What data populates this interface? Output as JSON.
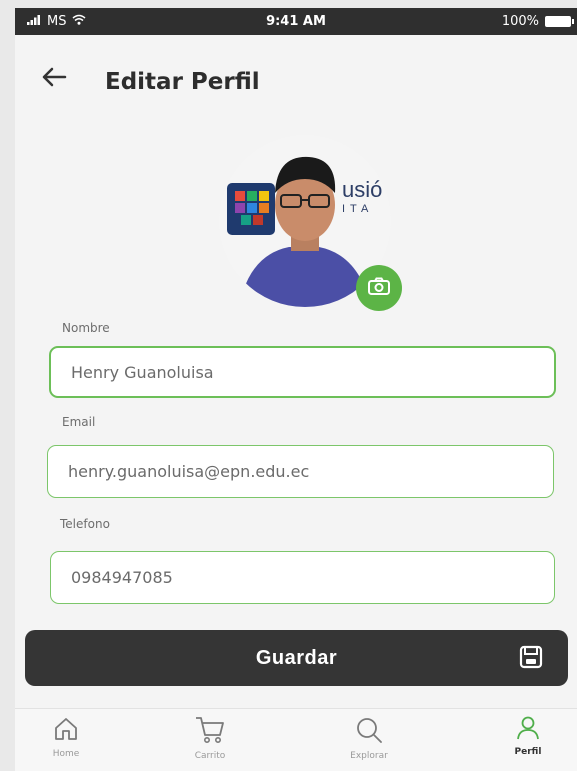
{
  "status_bar": {
    "carrier": "MS",
    "time": "9:41 AM",
    "battery": "100%"
  },
  "header": {
    "title": "Editar Perfil"
  },
  "form": {
    "name_label": "Nombre",
    "name_value": "Henry Guanoluisa",
    "email_label": "Email",
    "email_value": "henry.guanoluisa@epn.edu.ec",
    "phone_label": "Telefono",
    "phone_value": "0984947085"
  },
  "avatar_logo_text": {
    "line1": "usió",
    "line2": "ITA"
  },
  "save_button": {
    "label": "Guardar"
  },
  "bottom_nav": [
    {
      "label": "Home",
      "icon": "home-icon"
    },
    {
      "label": "Carrito",
      "icon": "cart-icon"
    },
    {
      "label": "Explorar",
      "icon": "search-icon"
    },
    {
      "label": "Perfil",
      "icon": "user-icon",
      "active": true
    }
  ],
  "colors": {
    "accent_green": "#6cbf58",
    "dark": "#353535"
  }
}
